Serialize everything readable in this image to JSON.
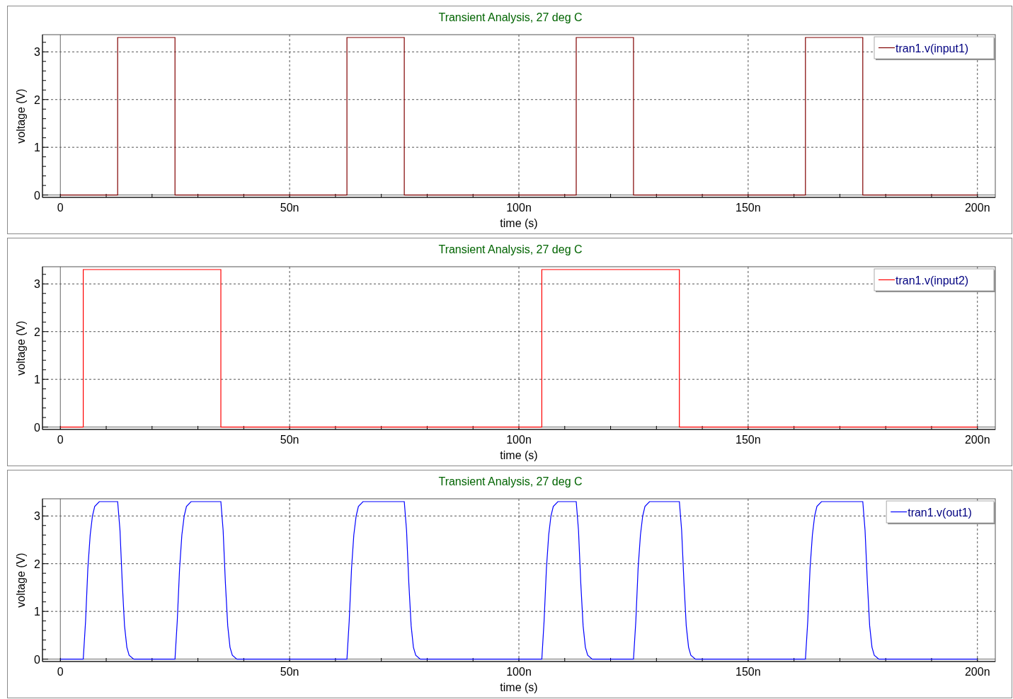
{
  "plots": [
    {
      "title": "Transient Analysis, 27 deg C",
      "chart_data": {
        "type": "line",
        "grid": true,
        "xlabel": "time (s)",
        "ylabel": "voltage (V)",
        "xlim": [
          -3.9,
          203.9
        ],
        "ylim": [
          -0.05,
          3.36
        ],
        "xticks": [
          {
            "value": 0,
            "label": "0"
          },
          {
            "value": 50,
            "label": "50n"
          },
          {
            "value": 100,
            "label": "100n"
          },
          {
            "value": 150,
            "label": "150n"
          },
          {
            "value": 200,
            "label": "200n"
          }
        ],
        "yticks": [
          0,
          1,
          2,
          3
        ],
        "x": [
          0,
          12.5,
          12.5,
          25,
          25,
          62.5,
          62.5,
          75,
          75,
          112.5,
          112.5,
          125,
          125,
          162.5,
          162.5,
          175,
          175,
          200
        ],
        "series": [
          {
            "name": "tran1.v(input1)",
            "color": "#800000",
            "values": [
              0,
              0,
              3.3,
              3.3,
              0,
              0,
              3.3,
              3.3,
              0,
              0,
              3.3,
              3.3,
              0,
              0,
              3.3,
              3.3,
              0,
              0
            ]
          }
        ]
      }
    },
    {
      "title": "Transient Analysis, 27 deg C",
      "chart_data": {
        "type": "line",
        "grid": true,
        "xlabel": "time (s)",
        "ylabel": "voltage (V)",
        "xlim": [
          -3.9,
          203.9
        ],
        "ylim": [
          -0.05,
          3.36
        ],
        "xticks": [
          {
            "value": 0,
            "label": "0"
          },
          {
            "value": 50,
            "label": "50n"
          },
          {
            "value": 100,
            "label": "100n"
          },
          {
            "value": 150,
            "label": "150n"
          },
          {
            "value": 200,
            "label": "200n"
          }
        ],
        "yticks": [
          0,
          1,
          2,
          3
        ],
        "x": [
          0,
          5,
          5,
          35,
          35,
          105,
          105,
          135,
          135,
          200
        ],
        "series": [
          {
            "name": "tran1.v(input2)",
            "color": "#ff0000",
            "values": [
              0,
              0,
              3.3,
              3.3,
              0,
              0,
              3.3,
              3.3,
              0,
              0
            ]
          }
        ]
      }
    },
    {
      "title": "Transient Analysis, 27 deg C",
      "chart_data": {
        "type": "line",
        "grid": true,
        "xlabel": "time (s)",
        "ylabel": "voltage (V)",
        "xlim": [
          -3.9,
          203.9
        ],
        "ylim": [
          -0.05,
          3.36
        ],
        "xticks": [
          {
            "value": 0,
            "label": "0"
          },
          {
            "value": 50,
            "label": "50n"
          },
          {
            "value": 100,
            "label": "100n"
          },
          {
            "value": 150,
            "label": "150n"
          },
          {
            "value": 200,
            "label": "200n"
          }
        ],
        "yticks": [
          0,
          1,
          2,
          3
        ],
        "x": [
          0,
          5,
          5.5,
          6,
          6.5,
          7,
          7.5,
          8.5,
          12.5,
          13,
          13.5,
          14,
          14.5,
          15,
          16,
          25,
          25.5,
          26,
          26.5,
          27,
          27.5,
          28.5,
          35,
          35.5,
          36,
          36.5,
          37,
          37.5,
          38.5,
          62.5,
          63,
          63.5,
          64,
          64.5,
          65,
          66,
          75,
          75.5,
          76,
          76.5,
          77,
          77.5,
          78.5,
          105,
          105.5,
          106,
          106.5,
          107,
          107.5,
          108.5,
          112.5,
          113,
          113.5,
          114,
          114.5,
          115,
          116,
          125,
          125.5,
          126,
          126.5,
          127,
          127.5,
          128.5,
          135,
          135.5,
          136,
          136.5,
          137,
          137.5,
          138.5,
          162.5,
          163,
          163.5,
          164,
          164.5,
          165,
          166,
          175,
          175.5,
          176,
          176.5,
          177,
          177.5,
          178.5,
          200
        ],
        "series": [
          {
            "name": "tran1.v(out1)",
            "color": "#0000ff",
            "values": [
              0,
              0,
              0.8,
              1.9,
              2.6,
              3.0,
              3.2,
              3.3,
              3.3,
              2.7,
              1.6,
              0.7,
              0.25,
              0.08,
              0,
              0,
              0.8,
              1.9,
              2.6,
              3.0,
              3.2,
              3.3,
              3.3,
              2.7,
              1.6,
              0.7,
              0.25,
              0.08,
              0,
              0,
              0.8,
              1.9,
              2.6,
              3.0,
              3.2,
              3.3,
              3.3,
              2.7,
              1.6,
              0.7,
              0.25,
              0.08,
              0,
              0,
              0.8,
              1.9,
              2.6,
              3.0,
              3.2,
              3.3,
              3.3,
              2.7,
              1.6,
              0.7,
              0.25,
              0.08,
              0,
              0,
              0.8,
              1.9,
              2.6,
              3.0,
              3.2,
              3.3,
              3.3,
              2.7,
              1.6,
              0.7,
              0.25,
              0.08,
              0,
              0,
              0.8,
              1.9,
              2.6,
              3.0,
              3.2,
              3.3,
              3.3,
              2.7,
              1.6,
              0.7,
              0.25,
              0.08,
              0,
              0
            ]
          }
        ]
      }
    }
  ]
}
